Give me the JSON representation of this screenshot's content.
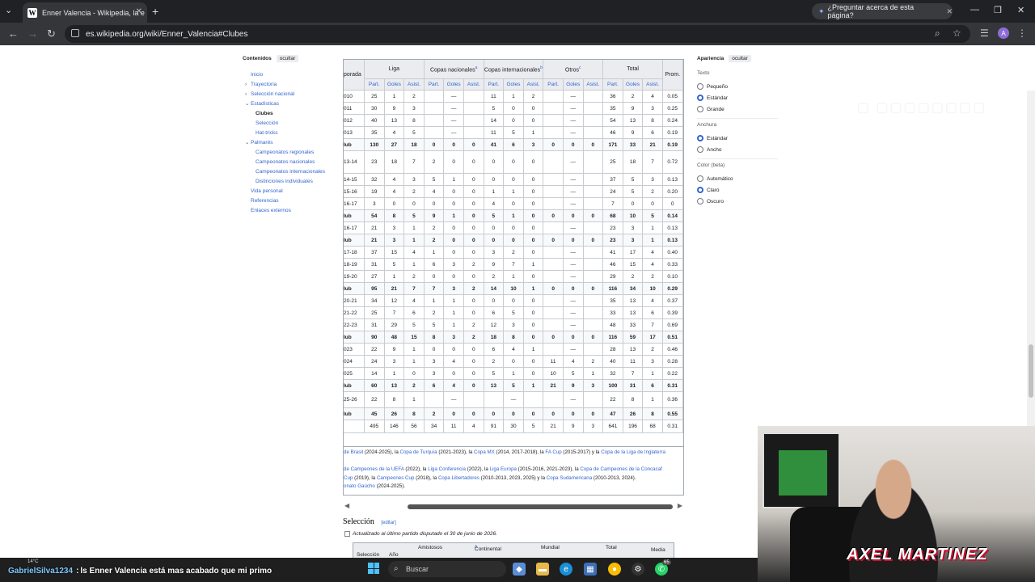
{
  "browser": {
    "tab_title": "Enner Valencia - Wikipedia, la e",
    "tab_favicon": "W",
    "new_tab": "+",
    "ask_label": "¿Preguntar acerca de esta página?",
    "url": "es.wikipedia.org/wiki/Enner_Valencia#Clubes",
    "avatar_initial": "A"
  },
  "toc": {
    "title": "Contenidos",
    "hide_label": "ocultar",
    "items": [
      {
        "label": "Inicio",
        "level": 0,
        "chevron": ""
      },
      {
        "label": "Trayectoria",
        "level": 0,
        "chevron": "›"
      },
      {
        "label": "Selección nacional",
        "level": 0,
        "chevron": "›"
      },
      {
        "label": "Estadísticas",
        "level": 0,
        "chevron": "⌄"
      },
      {
        "label": "Clubes",
        "level": 1,
        "chevron": "",
        "active": true
      },
      {
        "label": "Selección",
        "level": 1,
        "chevron": ""
      },
      {
        "label": "Hat-tricks",
        "level": 1,
        "chevron": ""
      },
      {
        "label": "Palmarés",
        "level": 0,
        "chevron": "⌄"
      },
      {
        "label": "Campeonatos regionales",
        "level": 1,
        "chevron": ""
      },
      {
        "label": "Campeonatos nacionales",
        "level": 1,
        "chevron": ""
      },
      {
        "label": "Campeonatos internacionales",
        "level": 1,
        "chevron": ""
      },
      {
        "label": "Distinciones individuales",
        "level": 1,
        "chevron": ""
      },
      {
        "label": "Vida personal",
        "level": 0,
        "chevron": ""
      },
      {
        "label": "Referencias",
        "level": 0,
        "chevron": ""
      },
      {
        "label": "Enlaces externos",
        "level": 0,
        "chevron": ""
      }
    ]
  },
  "stats_table": {
    "groups": [
      {
        "label": "porada",
        "span": 1
      },
      {
        "label": "Liga",
        "span": 3
      },
      {
        "label": "Copas nacionales",
        "sup": "a",
        "span": 3
      },
      {
        "label": "Copas internacionales",
        "sup": "b",
        "span": 3
      },
      {
        "label": "Otros",
        "sup": "c",
        "span": 3
      },
      {
        "label": "Total",
        "span": 3
      },
      {
        "label": "Prom.",
        "span": 1
      }
    ],
    "subheaders": [
      "Part.",
      "Goles",
      "Asist."
    ],
    "rows": [
      {
        "cells": [
          "010",
          "25",
          "1",
          "2",
          "",
          "—",
          "",
          "11",
          "1",
          "2",
          "",
          "—",
          "",
          "36",
          "2",
          "4",
          "0.05"
        ],
        "kind": ""
      },
      {
        "cells": [
          "011",
          "30",
          "9",
          "3",
          "",
          "—",
          "",
          "5",
          "0",
          "0",
          "",
          "—",
          "",
          "35",
          "9",
          "3",
          "0.25"
        ],
        "kind": ""
      },
      {
        "cells": [
          "012",
          "40",
          "13",
          "8",
          "",
          "—",
          "",
          "14",
          "0",
          "0",
          "",
          "—",
          "",
          "54",
          "13",
          "8",
          "0.24"
        ],
        "kind": ""
      },
      {
        "cells": [
          "013",
          "35",
          "4",
          "5",
          "",
          "—",
          "",
          "11",
          "5",
          "1",
          "",
          "—",
          "",
          "46",
          "9",
          "6",
          "0.19"
        ],
        "kind": ""
      },
      {
        "cells": [
          "lub",
          "130",
          "27",
          "18",
          "0",
          "0",
          "0",
          "41",
          "6",
          "3",
          "0",
          "0",
          "0",
          "171",
          "33",
          "21",
          "0.19"
        ],
        "kind": "bold"
      },
      {
        "cells": [
          "13-14",
          "23",
          "18",
          "7",
          "2",
          "0",
          "0",
          "0",
          "0",
          "0",
          "",
          "—",
          "",
          "25",
          "18",
          "7",
          "0.72"
        ],
        "kind": "tall"
      },
      {
        "cells": [
          "14-15",
          "32",
          "4",
          "3",
          "5",
          "1",
          "0",
          "0",
          "0",
          "0",
          "",
          "—",
          "",
          "37",
          "5",
          "3",
          "0.13"
        ],
        "kind": ""
      },
      {
        "cells": [
          "15-16",
          "19",
          "4",
          "2",
          "4",
          "0",
          "0",
          "1",
          "1",
          "0",
          "",
          "—",
          "",
          "24",
          "5",
          "2",
          "0.20"
        ],
        "kind": ""
      },
      {
        "cells": [
          "16-17",
          "3",
          "0",
          "0",
          "0",
          "0",
          "0",
          "4",
          "0",
          "0",
          "",
          "—",
          "",
          "7",
          "0",
          "0",
          "0"
        ],
        "kind": ""
      },
      {
        "cells": [
          "lub",
          "54",
          "8",
          "5",
          "9",
          "1",
          "0",
          "5",
          "1",
          "0",
          "0",
          "0",
          "0",
          "68",
          "10",
          "5",
          "0.14"
        ],
        "kind": "bold"
      },
      {
        "cells": [
          "16-17",
          "21",
          "3",
          "1",
          "2",
          "0",
          "0",
          "0",
          "0",
          "0",
          "",
          "—",
          "",
          "23",
          "3",
          "1",
          "0.13"
        ],
        "kind": ""
      },
      {
        "cells": [
          "lub",
          "21",
          "3",
          "1",
          "2",
          "0",
          "0",
          "0",
          "0",
          "0",
          "0",
          "0",
          "0",
          "23",
          "3",
          "1",
          "0.13"
        ],
        "kind": "bold"
      },
      {
        "cells": [
          "17-18",
          "37",
          "15",
          "4",
          "1",
          "0",
          "0",
          "3",
          "2",
          "0",
          "",
          "—",
          "",
          "41",
          "17",
          "4",
          "0.40"
        ],
        "kind": ""
      },
      {
        "cells": [
          "18-19",
          "31",
          "5",
          "1",
          "6",
          "3",
          "2",
          "9",
          "7",
          "1",
          "",
          "—",
          "",
          "46",
          "15",
          "4",
          "0.33"
        ],
        "kind": ""
      },
      {
        "cells": [
          "19-20",
          "27",
          "1",
          "2",
          "0",
          "0",
          "0",
          "2",
          "1",
          "0",
          "",
          "—",
          "",
          "29",
          "2",
          "2",
          "0.10"
        ],
        "kind": ""
      },
      {
        "cells": [
          "lub",
          "95",
          "21",
          "7",
          "7",
          "3",
          "2",
          "14",
          "10",
          "1",
          "0",
          "0",
          "0",
          "116",
          "34",
          "10",
          "0.29"
        ],
        "kind": "bold"
      },
      {
        "cells": [
          "20-21",
          "34",
          "12",
          "4",
          "1",
          "1",
          "0",
          "0",
          "0",
          "0",
          "",
          "—",
          "",
          "35",
          "13",
          "4",
          "0.37"
        ],
        "kind": ""
      },
      {
        "cells": [
          "21-22",
          "25",
          "7",
          "6",
          "2",
          "1",
          "0",
          "6",
          "5",
          "0",
          "",
          "—",
          "",
          "33",
          "13",
          "6",
          "0.39"
        ],
        "kind": ""
      },
      {
        "cells": [
          "22-23",
          "31",
          "29",
          "5",
          "5",
          "1",
          "2",
          "12",
          "3",
          "0",
          "",
          "—",
          "",
          "48",
          "33",
          "7",
          "0.69"
        ],
        "kind": ""
      },
      {
        "cells": [
          "lub",
          "90",
          "48",
          "15",
          "8",
          "3",
          "2",
          "18",
          "8",
          "0",
          "0",
          "0",
          "0",
          "116",
          "59",
          "17",
          "0.51"
        ],
        "kind": "bold"
      },
      {
        "cells": [
          "023",
          "22",
          "9",
          "1",
          "0",
          "0",
          "0",
          "6",
          "4",
          "1",
          "",
          "—",
          "",
          "28",
          "13",
          "2",
          "0.46"
        ],
        "kind": ""
      },
      {
        "cells": [
          "024",
          "24",
          "3",
          "1",
          "3",
          "4",
          "0",
          "2",
          "0",
          "0",
          "11",
          "4",
          "2",
          "40",
          "11",
          "3",
          "0.28"
        ],
        "kind": ""
      },
      {
        "cells": [
          "025",
          "14",
          "1",
          "0",
          "3",
          "0",
          "0",
          "5",
          "1",
          "0",
          "10",
          "5",
          "1",
          "32",
          "7",
          "1",
          "0.22"
        ],
        "kind": ""
      },
      {
        "cells": [
          "lub",
          "60",
          "13",
          "2",
          "6",
          "4",
          "0",
          "13",
          "5",
          "1",
          "21",
          "9",
          "3",
          "100",
          "31",
          "6",
          "0.31"
        ],
        "kind": "bold"
      },
      {
        "cells": [
          "25-26",
          "22",
          "8",
          "1",
          "",
          "—",
          "",
          "",
          "—",
          "",
          "",
          "—",
          "",
          "22",
          "8",
          "1",
          "0.36"
        ],
        "kind": "mid"
      },
      {
        "cells": [
          "lub",
          "45",
          "26",
          "8",
          "2",
          "0",
          "0",
          "0",
          "0",
          "0",
          "0",
          "0",
          "0",
          "47",
          "26",
          "8",
          "0.55"
        ],
        "kind": "bold"
      },
      {
        "cells": [
          "",
          "495",
          "146",
          "56",
          "34",
          "11",
          "4",
          "91",
          "30",
          "5",
          "21",
          "9",
          "3",
          "641",
          "196",
          "68",
          "0.31"
        ],
        "kind": "tot"
      }
    ]
  },
  "notes": [
    [
      {
        "t": "de Brasil",
        "l": true
      },
      {
        "t": " (2024-2025), la ",
        "l": false
      },
      {
        "t": "Copa de Turquía",
        "l": true
      },
      {
        "t": " (2021-2023), la ",
        "l": false
      },
      {
        "t": "Copa MX",
        "l": true
      },
      {
        "t": " (2014, 2017-2018), la ",
        "l": false
      },
      {
        "t": "FA Cup",
        "l": true
      },
      {
        "t": " (2015-2017) y la ",
        "l": false
      },
      {
        "t": "Copa de la Liga de Inglaterra",
        "l": true
      }
    ],
    [],
    [
      {
        "t": "de Campeones de la UEFA",
        "l": true
      },
      {
        "t": " (2022), la ",
        "l": false
      },
      {
        "t": "Liga Conferencia",
        "l": true
      },
      {
        "t": " (2022), la ",
        "l": false
      },
      {
        "t": "Liga Europa",
        "l": true
      },
      {
        "t": " (2015-2016, 2021-2023), la ",
        "l": false
      },
      {
        "t": "Copa de Campeones de la Concacaf",
        "l": true
      }
    ],
    [
      {
        "t": "Cup",
        "l": true
      },
      {
        "t": " (2019), la ",
        "l": false
      },
      {
        "t": "Campeones Cup",
        "l": true
      },
      {
        "t": " (2018), la ",
        "l": false
      },
      {
        "t": "Copa Libertadores",
        "l": true
      },
      {
        "t": " (2010-2013, 2023, 2025) y la ",
        "l": false
      },
      {
        "t": "Copa Sudamericana",
        "l": true
      },
      {
        "t": " (2010-2013, 2024).",
        "l": false
      }
    ],
    [
      {
        "t": "onato Gaúcho",
        "l": true
      },
      {
        "t": " (2024-2025).",
        "l": false
      }
    ]
  ],
  "selection": {
    "title": "Selección",
    "edit_label": "editar",
    "updated": "Actualizado al último partido disputado el 30 de junio de 2026.",
    "headers": [
      "Selección",
      "Año",
      "Amistosos",
      "Continental",
      "Mundial",
      "Total",
      "Media"
    ],
    "continental_sup": "A"
  },
  "appearance": {
    "title": "Apariencia",
    "hide_label": "ocultar",
    "groups": [
      {
        "label": "Texto",
        "options": [
          {
            "label": "Pequeño",
            "on": false
          },
          {
            "label": "Estándar",
            "on": true
          },
          {
            "label": "Grande",
            "on": false
          }
        ]
      },
      {
        "label": "Anchura",
        "options": [
          {
            "label": "Estándar",
            "on": true
          },
          {
            "label": "Ancho",
            "on": false
          }
        ]
      },
      {
        "label": "Color (beta)",
        "options": [
          {
            "label": "Automático",
            "on": false
          },
          {
            "label": "Claro",
            "on": true
          },
          {
            "label": "Oscuro",
            "on": false
          }
        ]
      }
    ]
  },
  "stream": {
    "chat_user": "GabrielSilva1234",
    "chat_sep": " : ",
    "chat_message": "ls Enner Valencia está mas acabado que mi primo",
    "brand": "AXEL MARTINEZ",
    "temp": "14°C"
  },
  "taskbar": {
    "search_placeholder": "Buscar",
    "whatsapp_badge": "65"
  }
}
